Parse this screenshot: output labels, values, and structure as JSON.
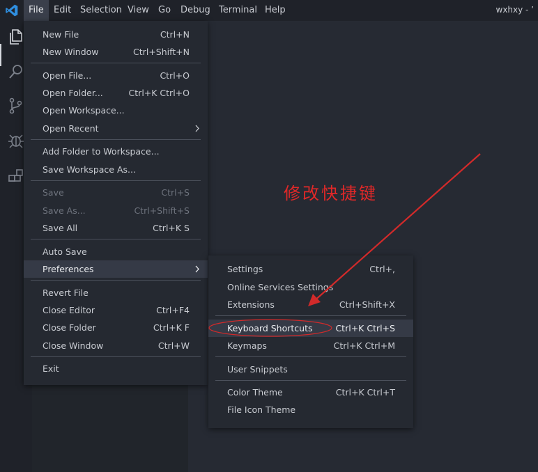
{
  "titlebar": {
    "menus": [
      "File",
      "Edit",
      "Selection",
      "View",
      "Go",
      "Debug",
      "Terminal",
      "Help"
    ],
    "right_text": "wxhxy - ’"
  },
  "activity_bar": {
    "icons": [
      "files-icon",
      "search-icon",
      "source-control-icon",
      "debug-icon",
      "extensions-icon"
    ]
  },
  "file_menu": {
    "items": [
      {
        "label": "New File",
        "key": "Ctrl+N"
      },
      {
        "label": "New Window",
        "key": "Ctrl+Shift+N"
      },
      {
        "label": "Open File...",
        "key": "Ctrl+O"
      },
      {
        "label": "Open Folder...",
        "key": "Ctrl+K Ctrl+O"
      },
      {
        "label": "Open Workspace...",
        "key": ""
      },
      {
        "label": "Open Recent",
        "key": ""
      },
      {
        "label": "Add Folder to Workspace...",
        "key": ""
      },
      {
        "label": "Save Workspace As...",
        "key": ""
      },
      {
        "label": "Save",
        "key": "Ctrl+S"
      },
      {
        "label": "Save As...",
        "key": "Ctrl+Shift+S"
      },
      {
        "label": "Save All",
        "key": "Ctrl+K S"
      },
      {
        "label": "Auto Save",
        "key": ""
      },
      {
        "label": "Preferences",
        "key": ""
      },
      {
        "label": "Revert File",
        "key": ""
      },
      {
        "label": "Close Editor",
        "key": "Ctrl+F4"
      },
      {
        "label": "Close Folder",
        "key": "Ctrl+K F"
      },
      {
        "label": "Close Window",
        "key": "Ctrl+W"
      },
      {
        "label": "Exit",
        "key": ""
      }
    ]
  },
  "preferences_menu": {
    "items": [
      {
        "label": "Settings",
        "key": "Ctrl+,"
      },
      {
        "label": "Online Services Settings",
        "key": ""
      },
      {
        "label": "Extensions",
        "key": "Ctrl+Shift+X"
      },
      {
        "label": "Keyboard Shortcuts",
        "key": "Ctrl+K Ctrl+S"
      },
      {
        "label": "Keymaps",
        "key": "Ctrl+K Ctrl+M"
      },
      {
        "label": "User Snippets",
        "key": ""
      },
      {
        "label": "Color Theme",
        "key": "Ctrl+K Ctrl+T"
      },
      {
        "label": "File Icon Theme",
        "key": ""
      }
    ]
  },
  "annotation": {
    "text": "修改快捷键",
    "color": "#e02828"
  },
  "colors": {
    "accent_logo": "#2f8fe0",
    "annotation": "#e02828"
  }
}
